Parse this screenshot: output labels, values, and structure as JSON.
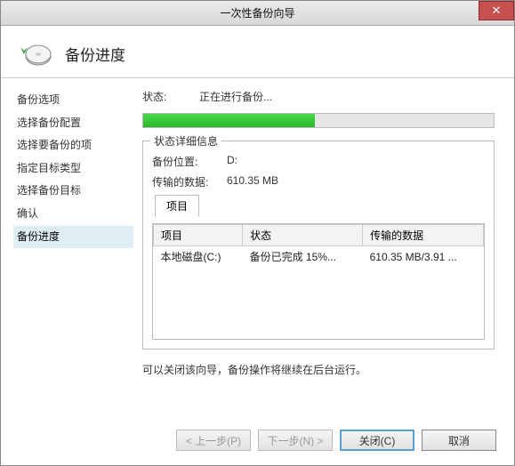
{
  "title": "一次性备份向导",
  "header": {
    "title": "备份进度"
  },
  "sidebar": {
    "items": [
      {
        "label": "备份选项"
      },
      {
        "label": "选择备份配置"
      },
      {
        "label": "选择要备份的项"
      },
      {
        "label": "指定目标类型"
      },
      {
        "label": "选择备份目标"
      },
      {
        "label": "确认"
      },
      {
        "label": "备份进度",
        "active": true
      }
    ]
  },
  "status": {
    "label": "状态:",
    "value": "正在进行备份..."
  },
  "progress": {
    "percent": 49
  },
  "details": {
    "legend": "状态详细信息",
    "rows": [
      {
        "label": "备份位置:",
        "value": "D:"
      },
      {
        "label": "传输的数据:",
        "value": "610.35 MB"
      }
    ],
    "tab_label": "项目",
    "columns": [
      "项目",
      "状态",
      "传输的数据"
    ],
    "data": [
      {
        "item": "本地磁盘(C:)",
        "state": "备份已完成 15%...",
        "transfer": "610.35 MB/3.91 ..."
      }
    ]
  },
  "close_info": "可以关闭该向导，备份操作将继续在后台运行。",
  "buttons": {
    "prev": "< 上一步(P)",
    "next": "下一步(N) >",
    "close": "关闭(C)",
    "cancel": "取消"
  }
}
